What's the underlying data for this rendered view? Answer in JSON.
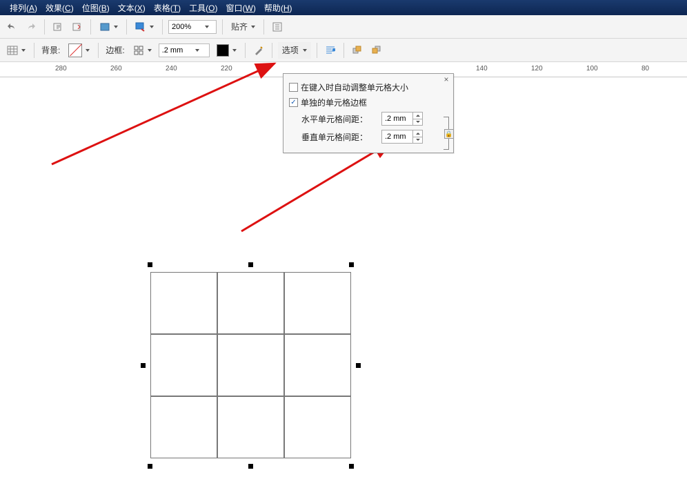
{
  "menu": {
    "items": [
      {
        "label": "排列",
        "key": "A"
      },
      {
        "label": "效果",
        "key": "C"
      },
      {
        "label": "位图",
        "key": "B"
      },
      {
        "label": "文本",
        "key": "X"
      },
      {
        "label": "表格",
        "key": "T"
      },
      {
        "label": "工具",
        "key": "O"
      },
      {
        "label": "窗口",
        "key": "W"
      },
      {
        "label": "帮助",
        "key": "H"
      }
    ]
  },
  "toolbar1": {
    "zoom_value": "200%",
    "snap_label": "贴齐"
  },
  "toolbar2": {
    "bg_label": "背景:",
    "border_label": "边框:",
    "border_width": ".2 mm",
    "options_label": "选项"
  },
  "ruler": {
    "ticks": [
      "280",
      "260",
      "240",
      "220",
      "140",
      "120",
      "100",
      "80"
    ]
  },
  "popup": {
    "auto_resize_label": "在键入时自动调整单元格大小",
    "auto_resize_checked": false,
    "separate_border_label": "单独的单元格边框",
    "separate_border_checked": true,
    "horizontal_gap_label": "水平单元格间距：",
    "horizontal_gap_value": ".2 mm",
    "vertical_gap_label": "垂直单元格间距：",
    "vertical_gap_value": ".2 mm"
  }
}
